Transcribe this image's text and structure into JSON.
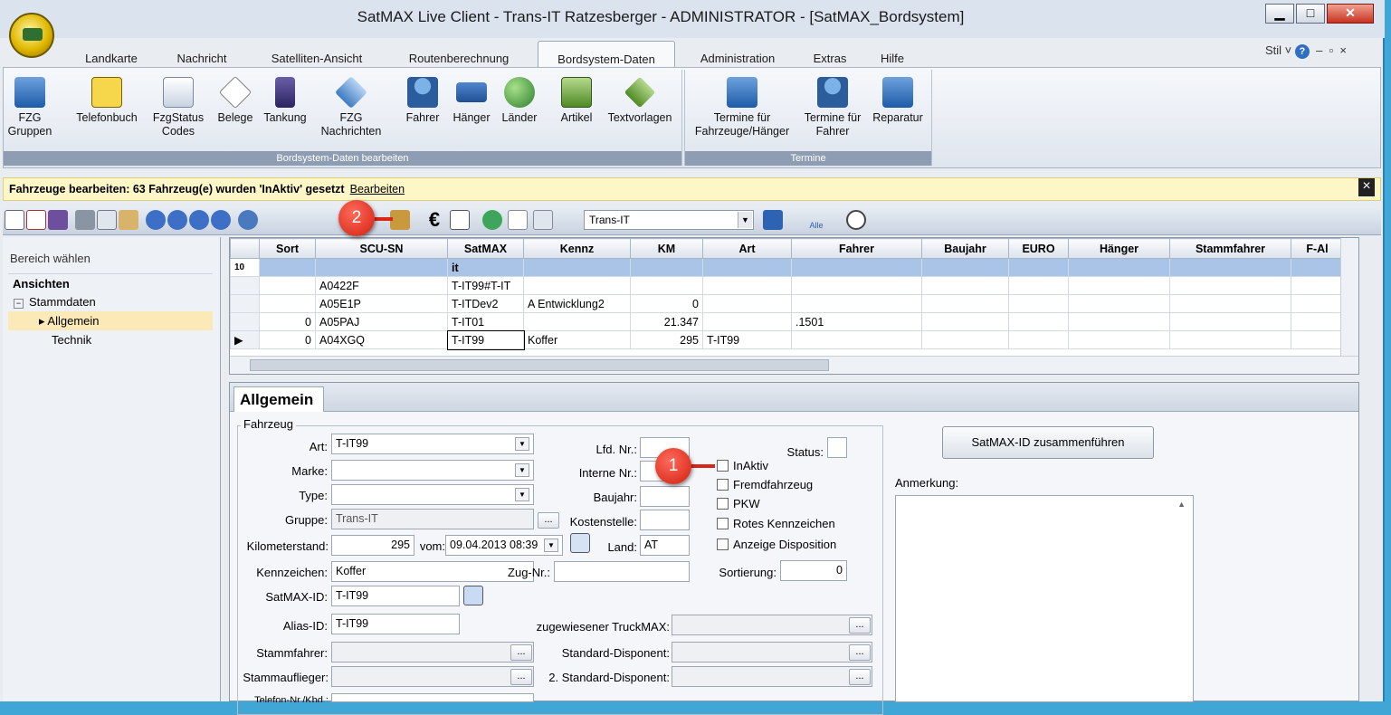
{
  "window": {
    "title": "SatMAX Live Client - Trans-IT Ratzesberger - ADMINISTRATOR - [SatMAX_Bordsystem]"
  },
  "menu_tabs": [
    "Landkarte",
    "Nachricht",
    "Satelliten-Ansicht",
    "Routenberechnung",
    "Bordsystem-Daten",
    "Administration",
    "Extras",
    "Hilfe"
  ],
  "stil_label": "Stil",
  "ribbon": {
    "group1": {
      "caption": "Bordsystem-Daten bearbeiten",
      "buttons": [
        "FZG Gruppen",
        "Telefonbuch",
        "FzgStatus Codes",
        "Belege",
        "Tankung",
        "FZG Nachrichten",
        "Fahrer",
        "Hänger",
        "Länder",
        "Artikel",
        "Textvorlagen"
      ]
    },
    "group2": {
      "caption": "Termine",
      "buttons": [
        "Termine für Fahrzeuge/Hänger",
        "Termine für Fahrer",
        "Reparatur"
      ]
    }
  },
  "notice": {
    "text": "Fahrzeuge bearbeiten: 63 Fahrzeug(e) wurden 'InAktiv' gesetzt",
    "link": "Bearbeiten"
  },
  "toolbar": {
    "company": "Trans-IT",
    "alle": "Alle"
  },
  "left": {
    "header": "Bereich wählen",
    "section": "Ansichten",
    "items": [
      "Stammdaten",
      "Allgemein",
      "Technik"
    ]
  },
  "grid": {
    "row_count_label": "10",
    "columns": [
      "Sort",
      "SCU-SN",
      "SatMAX",
      "Kennz",
      "KM",
      "Art",
      "Fahrer",
      "Baujahr",
      "EURO",
      "Hänger",
      "Stammfahrer",
      "F-Al"
    ],
    "filter": [
      "",
      "",
      "it",
      "",
      "",
      "",
      "",
      "",
      "",
      "",
      "",
      ""
    ],
    "rows": [
      [
        "",
        "A0422F",
        "T-IT99#T-IT",
        "",
        "",
        "",
        "",
        "",
        "",
        "",
        "",
        ""
      ],
      [
        "",
        "A05E1P",
        "T-ITDev2",
        "A Entwicklung2",
        "0",
        "",
        "",
        "",
        "",
        "",
        "",
        ""
      ],
      [
        "0",
        "A05PAJ",
        "T-IT01",
        "",
        "21.347",
        "",
        ".1501",
        "",
        "",
        "",
        "",
        ""
      ],
      [
        "0",
        "A04XGQ",
        "T-IT99",
        "Koffer",
        "295",
        "T-IT99",
        "",
        "",
        "",
        "",
        "",
        ""
      ]
    ]
  },
  "detail": {
    "tab": "Allgemein",
    "legend": "Fahrzeug",
    "labels": {
      "art": "Art:",
      "marke": "Marke:",
      "type": "Type:",
      "gruppe": "Gruppe:",
      "km": "Kilometerstand:",
      "vom": "vom:",
      "kennzeichen": "Kennzeichen:",
      "satmaxid": "SatMAX-ID:",
      "alias": "Alias-ID:",
      "stammfahrer": "Stammfahrer:",
      "stammauflieger": "Stammauflieger:",
      "telefon": "Telefon-Nr./Kbd.:",
      "lfd": "Lfd. Nr.:",
      "interne": "Interne Nr.:",
      "baujahr": "Baujahr:",
      "kostenstelle": "Kostenstelle:",
      "land": "Land:",
      "zug": "Zug-Nr.:",
      "status": "Status:",
      "sortierung": "Sortierung:",
      "truckmax": "zugewiesener TruckMAX:",
      "disponent": "Standard-Disponent:",
      "disponent2": "2. Standard-Disponent:",
      "anmerkung": "Anmerkung:"
    },
    "values": {
      "art": "T-IT99",
      "marke": "",
      "type": "",
      "gruppe": "Trans-IT",
      "km": "295",
      "vom": "09.04.2013 08:39",
      "kennzeichen": "Koffer",
      "satmaxid": "T-IT99",
      "alias": "T-IT99",
      "land": "AT",
      "sortierung": "0"
    },
    "checkboxes": [
      "InAktiv",
      "Fremdfahrzeug",
      "PKW",
      "Rotes Kennzeichen",
      "Anzeige Disposition"
    ],
    "merge_button": "SatMAX-ID zusammenführen"
  },
  "badges": [
    "1",
    "2"
  ]
}
